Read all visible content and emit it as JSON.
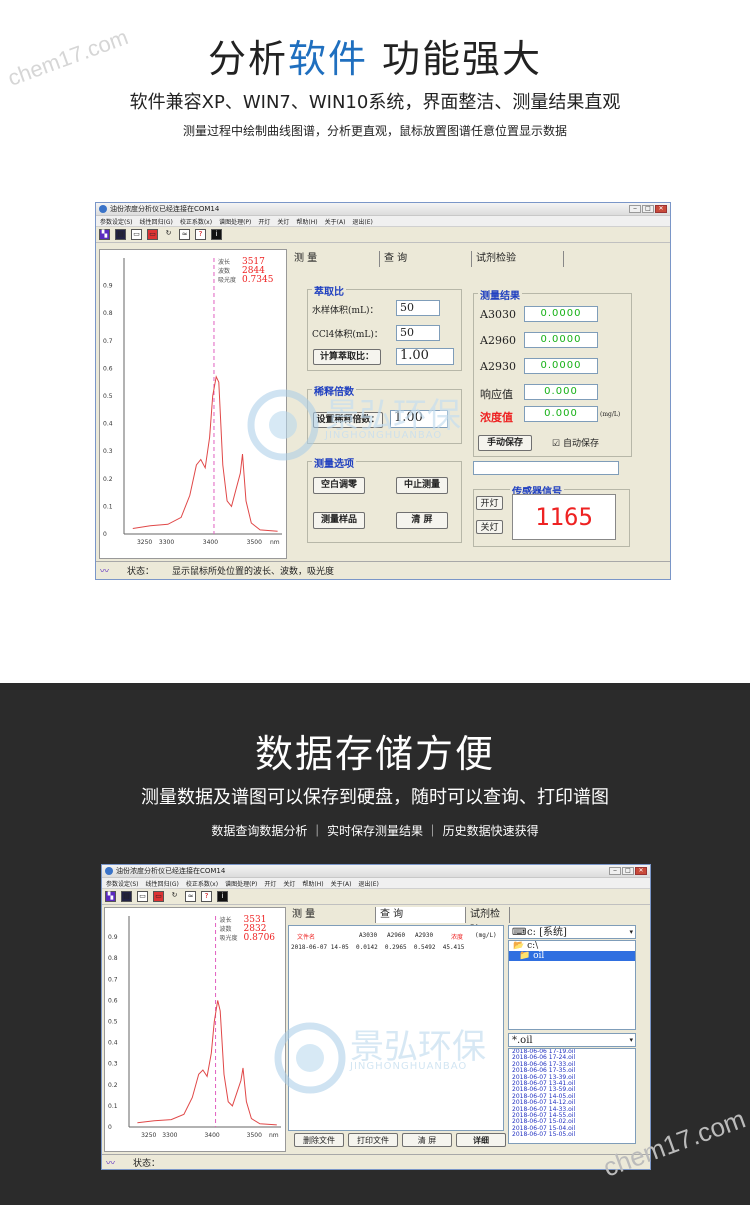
{
  "top": {
    "title_a": "分析",
    "title_b": "软件",
    "title_c": " 功能强大",
    "subtitle": "软件兼容XP、WIN7、WIN10系统，界面整洁、测量结果直观",
    "desc": "测量过程中绘制曲线图谱，分析更直观，鼠标放置图谱任意位置显示数据"
  },
  "bottom": {
    "title": "数据存储方便",
    "subtitle": "测量数据及谱图可以保存到硬盘，随时可以查询、打印谱图",
    "desc": "数据查询数据分析 ｜ 实时保存测量结果 ｜ 历史数据快速获得"
  },
  "watermark": {
    "site": "chem17.com",
    "brand_cn": "景弘环保",
    "brand_en": "JINGHONGHUANBAO"
  },
  "window": {
    "title": "油份浓度分析仪已经连接在COM14",
    "menu": [
      "参数设定(S)",
      "线性回归(G)",
      "校正系数(x)",
      "谱图处理(P)",
      "开灯",
      "关灯",
      "帮助(H)",
      "关于(A)",
      "退出(E)"
    ],
    "tabs": [
      "测 量",
      "查 询",
      "试剂检验"
    ],
    "status_label": "状态：",
    "yticks": [
      "0.9",
      "0.8",
      "0.7",
      "0.6",
      "0.5",
      "0.4",
      "0.3",
      "0.2",
      "0.1",
      "0\n(A)"
    ],
    "xticks": [
      "3250",
      "3300",
      "3400",
      "3500",
      "nm"
    ],
    "ro_keys": [
      "波长",
      "波数",
      "吸光度"
    ]
  },
  "win1": {
    "readout": [
      "3517",
      "2844",
      "0.7345"
    ],
    "status_text": "显示鼠标所处位置的波长、波数，吸光度",
    "extract": {
      "title": "萃取比",
      "water_label": "水样体积(mL)：",
      "water_val": "50",
      "ccl_label": "CCl4体积(mL)：",
      "ccl_val": "50",
      "calc_btn": "计算萃取比：",
      "ratio": "1.00"
    },
    "dilution": {
      "title": "稀释倍数",
      "set_btn": "设置稀释倍数：",
      "val": "1.00"
    },
    "options": {
      "title": "测量选项",
      "blank": "空白调零",
      "stop": "中止测量",
      "measure": "测量样品",
      "clear": "清  屏"
    },
    "result": {
      "title": "测量结果",
      "rows": [
        {
          "k": "A3030",
          "v": "0.0000"
        },
        {
          "k": "A2960",
          "v": "0.0000"
        },
        {
          "k": "A2930",
          "v": "0.0000"
        },
        {
          "k": "响应值",
          "v": "0.000"
        }
      ],
      "conc_label": "浓度值",
      "conc_val": "0.000",
      "unit": "(mg/L)",
      "save_btn": "手动保存",
      "auto_label": "自动保存",
      "auto_check": "☑"
    },
    "sensor": {
      "title": "传感器信号",
      "on": "开灯",
      "off": "关灯",
      "value": "1165"
    }
  },
  "win2": {
    "readout": [
      "3531",
      "2832",
      "0.8706"
    ],
    "headers": [
      "文件名",
      "A3030",
      "A2960",
      "A2930",
      "浓度",
      "(mg/L)"
    ],
    "row": [
      "2018-06-07 14-05",
      "0.0142",
      "0.2965",
      "0.5492",
      "45.415"
    ],
    "drive": "c: [系统]",
    "tree": [
      "c:\\",
      "oil"
    ],
    "filter": "*.oil",
    "files": [
      "2018-06-06 17-19.oil",
      "2018-06-06 17-24.oil",
      "2018-06-06 17-33.oil",
      "2018-06-06 17-35.oil",
      "2018-06-07 13-39.oil",
      "2018-06-07 13-41.oil",
      "2018-06-07 13-59.oil",
      "2018-06-07 14-05.oil",
      "2018-06-07 14-12.oil",
      "2018-06-07 14-33.oil",
      "2018-06-07 14-55.oil",
      "2018-06-07 15-02.oil",
      "2018-06-07 15-04.oil",
      "2018-06-07 15-05.oil"
    ],
    "buttons": [
      "删除文件",
      "打印文件",
      "清 屏",
      "详细"
    ]
  }
}
